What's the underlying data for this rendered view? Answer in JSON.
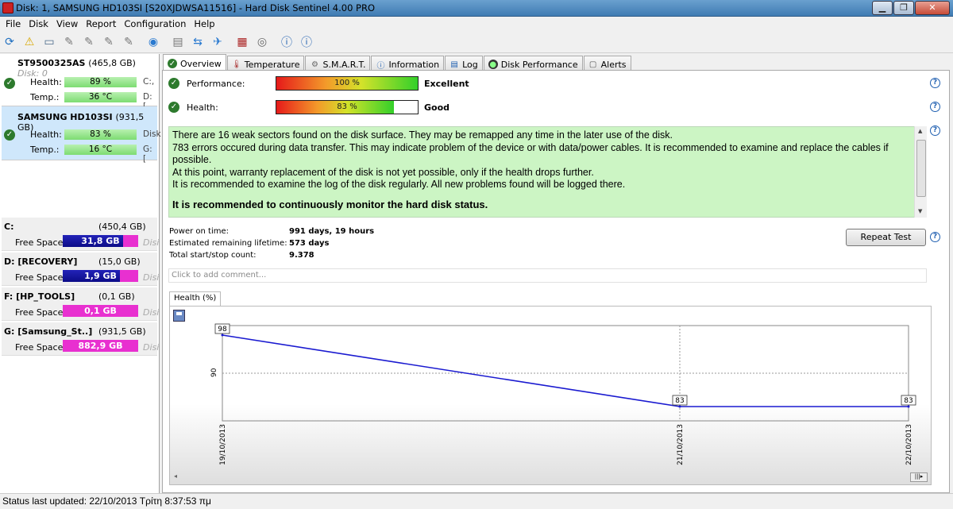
{
  "window": {
    "title": "Disk: 1, SAMSUNG HD103SI [S20XJDWSA11516]  -  Hard Disk Sentinel 4.00 PRO",
    "min": "▁",
    "max": "❐",
    "close": "✕"
  },
  "menu": [
    "File",
    "Disk",
    "View",
    "Report",
    "Configuration",
    "Help"
  ],
  "disks": [
    {
      "name": "ST9500325AS",
      "size": "(465,8 GB)",
      "sub": "Disk: 0",
      "health_label": "Health:",
      "health": "89 %",
      "temp_label": "Temp.:",
      "temp": "36 °C",
      "letters1": "C:,",
      "letters2": "D: ["
    },
    {
      "name": "SAMSUNG HD103SI",
      "size": "(931,5 GB)",
      "health_label": "Health:",
      "health": "83 %",
      "temp_label": "Temp.:",
      "temp": "16 °C",
      "letters1": "Disk",
      "letters2": "G: ["
    }
  ],
  "partitions": [
    {
      "name": "C:",
      "size": "(450,4 GB)",
      "free_label": "Free Space",
      "free": "31,8 GB",
      "used_fraction": 0.07,
      "disk_label": "Disi"
    },
    {
      "name": "D: [RECOVERY]",
      "size": "(15,0 GB)",
      "free_label": "Free Space",
      "free": "1,9 GB",
      "used_fraction": 0.13,
      "disk_label": "Disi"
    },
    {
      "name": "F: [HP_TOOLS]",
      "size": "(0,1 GB)",
      "free_label": "Free Space",
      "free": "0,1 GB",
      "used_fraction": 0.0,
      "disk_label": "Disi"
    },
    {
      "name": "G: [Samsung_St..]",
      "size": "(931,5 GB)",
      "free_label": "Free Space",
      "free": "882,9 GB",
      "used_fraction": 0.0,
      "disk_label": "Disi"
    }
  ],
  "tabs": [
    {
      "label": "Overview",
      "icon": "check-icon"
    },
    {
      "label": "Temperature",
      "icon": "thermometer-icon"
    },
    {
      "label": "S.M.A.R.T.",
      "icon": "smart-icon"
    },
    {
      "label": "Information",
      "icon": "info-icon"
    },
    {
      "label": "Log",
      "icon": "log-icon"
    },
    {
      "label": "Disk Performance",
      "icon": "performance-icon"
    },
    {
      "label": "Alerts",
      "icon": "alerts-icon"
    }
  ],
  "overview": {
    "performance_label": "Performance:",
    "performance_value": "100 %",
    "performance_fraction": 1.0,
    "performance_verdict": "Excellent",
    "health_label": "Health:",
    "health_value": "83 %",
    "health_fraction": 0.83,
    "health_verdict": "Good",
    "messages": [
      "There are 16 weak sectors found on the disk surface. They may be remapped any time in the later use of the disk.",
      "783 errors occured during data transfer. This may indicate problem of the device or with data/power cables. It is recommended to examine and replace the cables if possible.",
      "At this point, warranty replacement of the disk is not yet possible, only if the health drops further.",
      "It is recommended to examine the log of the disk regularly. All new problems found will be logged there."
    ],
    "recommendation": "It is recommended to continuously monitor the hard disk status.",
    "power_on_label": "Power on time:",
    "power_on_value": "991 days, 19 hours",
    "lifetime_label": "Estimated remaining lifetime:",
    "lifetime_value": "573 days",
    "startstop_label": "Total start/stop count:",
    "startstop_value": "9.378",
    "repeat_test": "Repeat Test",
    "comment_placeholder": "Click to add comment..."
  },
  "chart_data": {
    "type": "line",
    "tab_label": "Health (%)",
    "x": [
      "19/10/2013",
      "21/10/2013",
      "22/10/2013"
    ],
    "series": [
      {
        "values": [
          98,
          83,
          83
        ]
      }
    ],
    "y_tick_label": "90",
    "ylim": [
      80,
      100
    ],
    "grid": true,
    "line_color": "#1a1ad0"
  },
  "status": "Status last updated: 22/10/2013 Τρίτη 8:37:53 πμ"
}
